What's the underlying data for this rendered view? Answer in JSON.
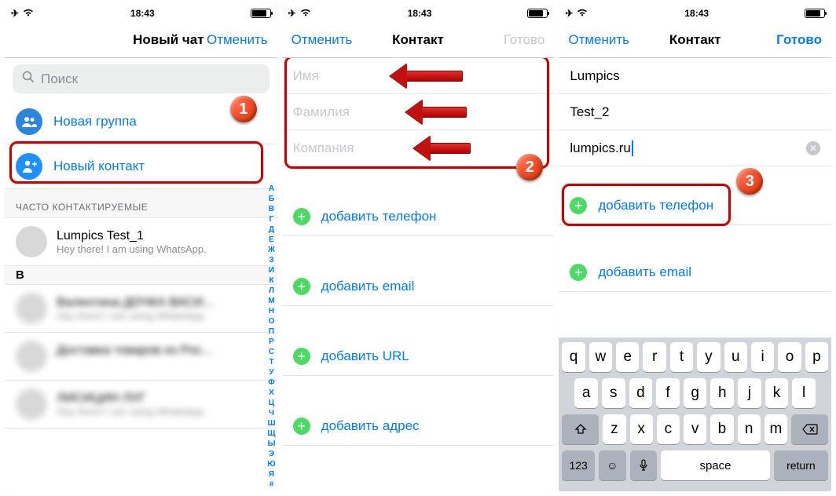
{
  "statusbar": {
    "time": "18:43"
  },
  "screen1": {
    "nav": {
      "title": "Новый чат",
      "cancel": "Отменить"
    },
    "search_placeholder": "Поиск",
    "new_group": "Новая группа",
    "new_contact": "Новый контакт",
    "frequent_header": "ЧАСТО КОНТАКТИРУЕМЫЕ",
    "contact1": {
      "name": "Lumpics Test_1",
      "status": "Hey there! I am using WhatsApp."
    },
    "letter_b": "В",
    "index_letters": [
      "А",
      "Б",
      "В",
      "Г",
      "Д",
      "Е",
      "Ж",
      "З",
      "И",
      "К",
      "Л",
      "М",
      "Н",
      "О",
      "П",
      "Р",
      "С",
      "Т",
      "У",
      "Ф",
      "Х",
      "Ц",
      "Ч",
      "Ш",
      "Щ",
      "Ы",
      "Э",
      "Ю",
      "Я",
      "#"
    ],
    "badge": "1"
  },
  "screen2": {
    "nav": {
      "cancel": "Отменить",
      "title": "Контакт",
      "done": "Готово"
    },
    "fields": {
      "first": "Имя",
      "last": "Фамилия",
      "company": "Компания"
    },
    "add_phone": "добавить телефон",
    "add_email": "добавить email",
    "add_url": "добавить URL",
    "add_address": "добавить адрес",
    "badge": "2"
  },
  "screen3": {
    "nav": {
      "cancel": "Отменить",
      "title": "Контакт",
      "done": "Готово"
    },
    "first": "Lumpics",
    "last": "Test_2",
    "company": "lumpics.ru",
    "add_phone": "добавить телефон",
    "add_email": "добавить email",
    "badge": "3",
    "keyboard": {
      "row1": [
        "q",
        "w",
        "e",
        "r",
        "t",
        "y",
        "u",
        "i",
        "o",
        "p"
      ],
      "row2": [
        "a",
        "s",
        "d",
        "f",
        "g",
        "h",
        "j",
        "k",
        "l"
      ],
      "row3": [
        "z",
        "x",
        "c",
        "v",
        "b",
        "n",
        "m"
      ],
      "k123": "123",
      "space": "space",
      "return": "return"
    }
  }
}
